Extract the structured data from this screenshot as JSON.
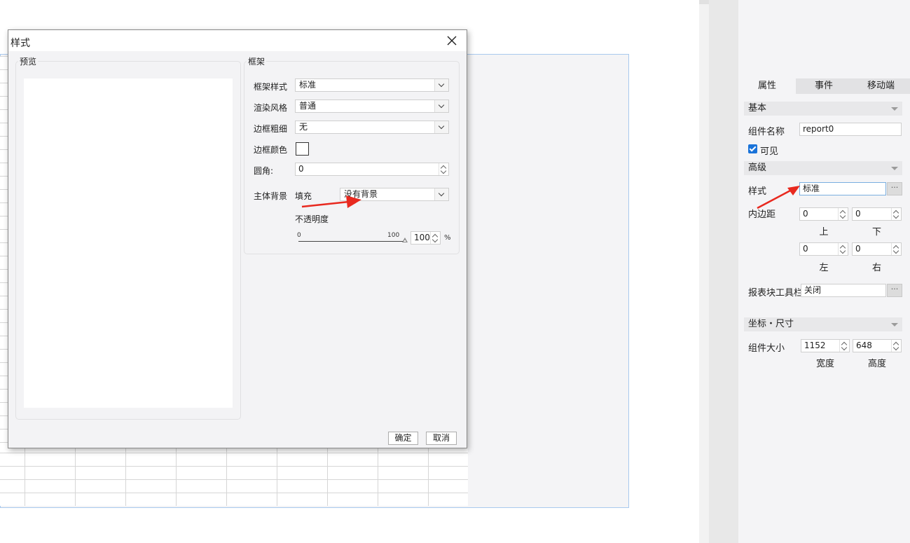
{
  "dialog": {
    "title": "样式",
    "preview_label": "预览",
    "frame_label": "框架",
    "frame_style_label": "框架样式",
    "frame_style_value": "标准",
    "render_style_label": "渲染风格",
    "render_style_value": "普通",
    "border_width_label": "边框粗细",
    "border_width_value": "无",
    "border_color_label": "边框颜色",
    "corner_label": "圆角:",
    "corner_value": "0",
    "body_bg_label": "主体背景",
    "fill_label": "填充",
    "fill_value": "没有背景",
    "opacity_label": "不透明度",
    "slider_min": "0",
    "slider_max": "100",
    "opacity_value": "100",
    "opacity_unit": "%",
    "ok_label": "确定",
    "cancel_label": "取消"
  },
  "panel": {
    "tabs": [
      "属性",
      "事件",
      "移动端"
    ],
    "basic_section": "基本",
    "component_name_label": "组件名称",
    "component_name_value": "report0",
    "visible_label": "可见",
    "advanced_section": "高级",
    "style_label": "样式",
    "style_value": "标准",
    "dots": "···",
    "padding_label": "内边距",
    "padding_top": "0",
    "padding_bottom": "0",
    "padding_left": "0",
    "padding_right": "0",
    "top_label": "上",
    "bottom_label": "下",
    "left_label": "左",
    "right_label": "右",
    "toolbar_label": "报表块工具栏",
    "toolbar_value": "关闭",
    "coords_section": "坐标・尺寸",
    "size_label": "组件大小",
    "width_value": "1152",
    "height_value": "648",
    "width_label": "宽度",
    "height_label": "高度"
  },
  "colors": {
    "accent": "#1a73d9",
    "annotation_arrow": "#e8291f",
    "canvas_border": "#a9c9ee"
  }
}
